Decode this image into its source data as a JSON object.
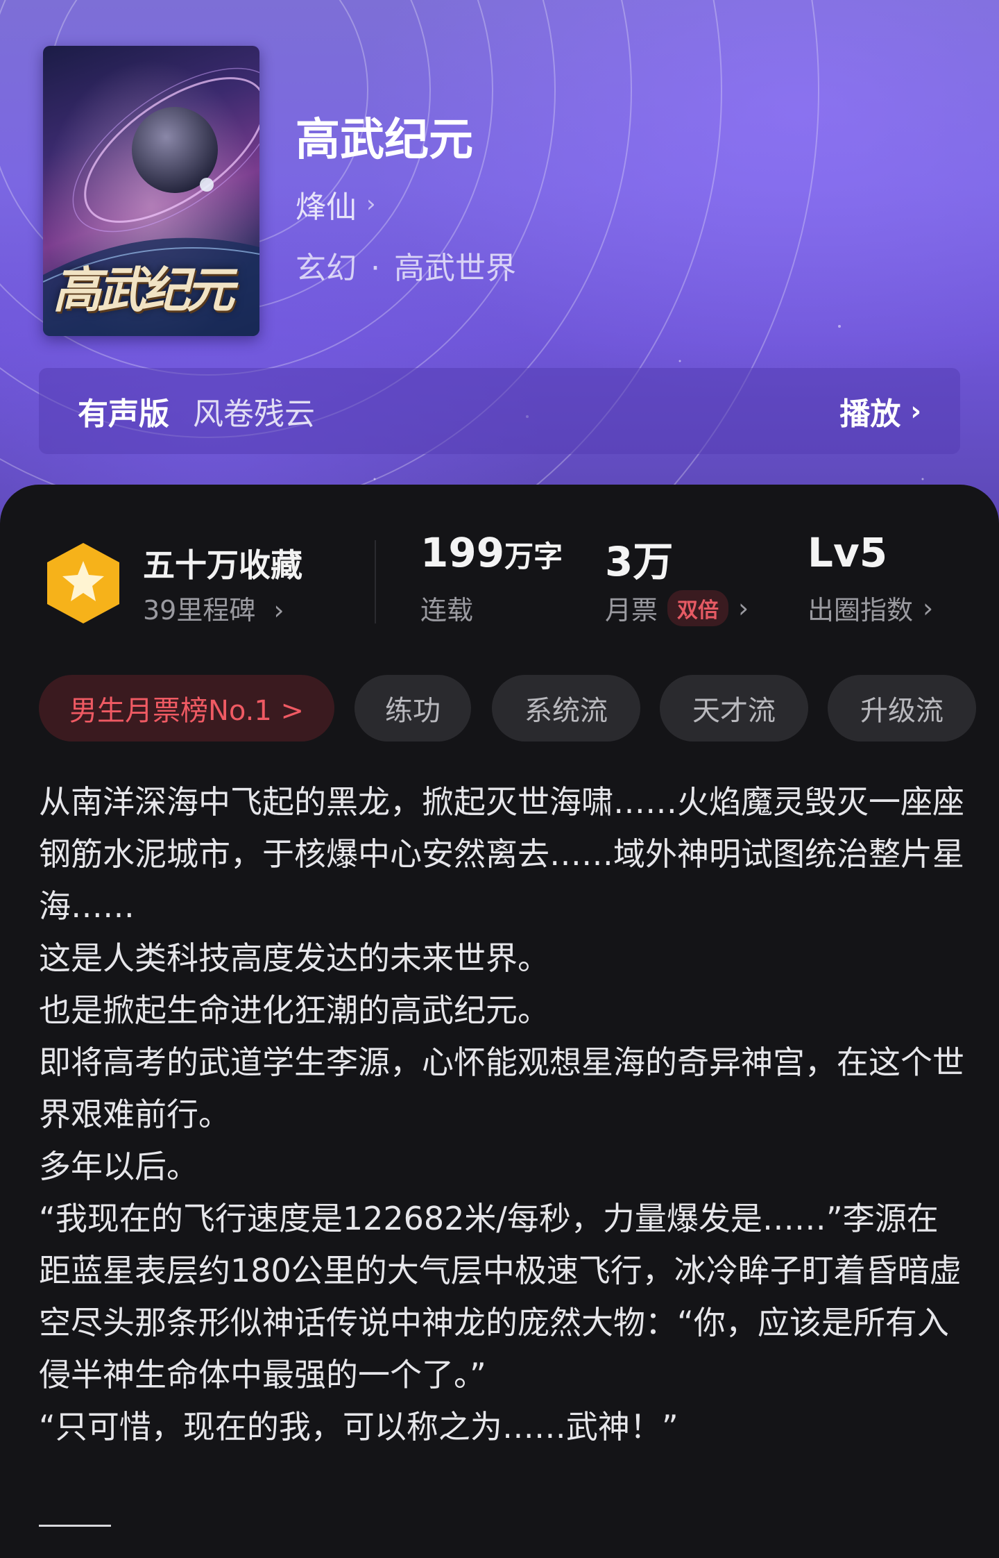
{
  "book": {
    "title": "高武纪元",
    "cover_title": "高武纪元",
    "author": "烽仙",
    "genre": "玄幻",
    "subgenre": "高武世界"
  },
  "audio": {
    "label": "有声版",
    "narrator": "风卷残云",
    "play_label": "播放"
  },
  "stats": {
    "collect_title": "五十万收藏",
    "collect_sub": "39里程碑",
    "words_value": "199",
    "words_unit": "万字",
    "words_label": "连载",
    "tickets_value": "3万",
    "tickets_label": "月票",
    "tickets_badge": "双倍",
    "index_value": "Lv5",
    "index_label": "出圈指数"
  },
  "tags": [
    {
      "label": "男生月票榜No.1 >"
    },
    {
      "label": "练功"
    },
    {
      "label": "系统流"
    },
    {
      "label": "天才流"
    },
    {
      "label": "升级流"
    }
  ],
  "synopsis": [
    "从南洋深海中飞起的黑龙，掀起灭世海啸……火焰魔灵毁灭一座座钢筋水泥城市，于核爆中心安然离去……域外神明试图统治整片星海……",
    "这是人类科技高度发达的未来世界。",
    "也是掀起生命进化狂潮的高武纪元。",
    "即将高考的武道学生李源，心怀能观想星海的奇异神宫，在这个世界艰难前行。",
    "多年以后。",
    "“我现在的飞行速度是122682米/每秒，力量爆发是……”李源在距蓝星表层约180公里的大气层中极速飞行，冰冷眸子盯着昏暗虚空尽头那条形似神话传说中神龙的庞然大物：“你，应该是所有入侵半神生命体中最强的一个了。”",
    "“只可惜，现在的我，可以称之为……武神！”"
  ],
  "icons": {
    "author_chevron": "chevron-right-icon",
    "play_chevron": "chevron-right-icon",
    "badge": "star-hexagon-badge-icon"
  },
  "colors": {
    "header_purple": "#7b67e2",
    "panel_dark": "#141417",
    "rank_red": "#ef5a63",
    "badge_gold": "#f6b21a"
  }
}
